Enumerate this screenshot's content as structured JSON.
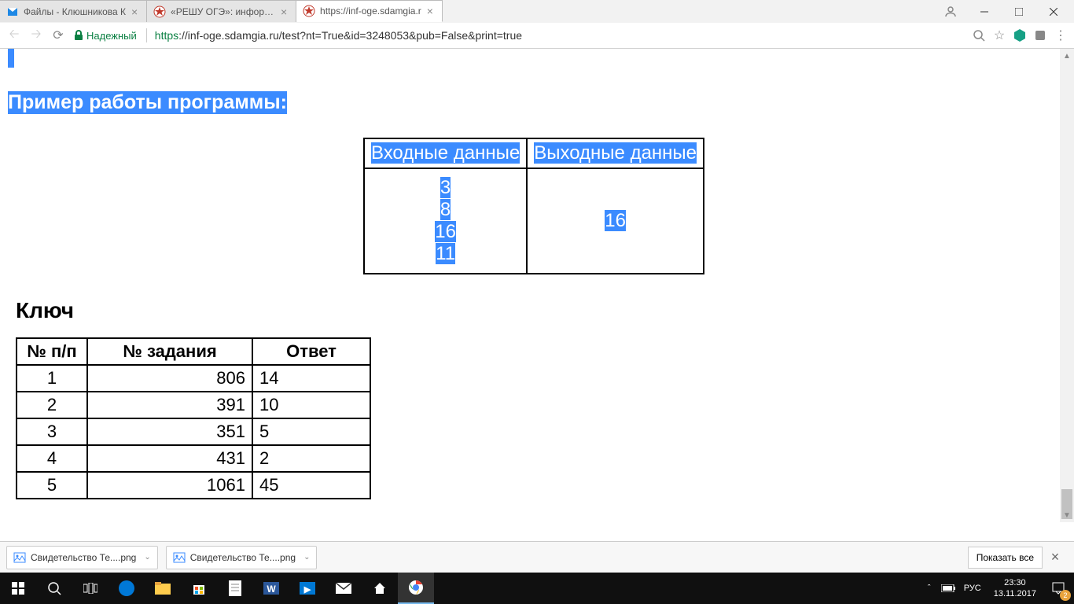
{
  "tabs": [
    {
      "title": "Файлы - Клюшникова К",
      "icon": "mail-blue"
    },
    {
      "title": "«РЕШУ ОГЭ»: информат",
      "icon": "red-star"
    },
    {
      "title": "https://inf-oge.sdamgia.r",
      "icon": "red-star",
      "active": true
    }
  ],
  "url": {
    "secure_label": "Надежный",
    "host": "https",
    "full": "://inf-oge.sdamgia.ru/test?nt=True&id=3248053&pub=False&print=true"
  },
  "page": {
    "heading": "Пример работы программы:",
    "example": {
      "headers": [
        "Входные данные",
        "Выходные данные"
      ],
      "input_lines": [
        "3",
        "8",
        "16",
        "11"
      ],
      "output": "16"
    },
    "key_heading": "Ключ",
    "key_headers": [
      "№ п/п",
      "№ задания",
      "Ответ"
    ],
    "key_rows": [
      {
        "n": "1",
        "task": "806",
        "ans": "14"
      },
      {
        "n": "2",
        "task": "391",
        "ans": "10"
      },
      {
        "n": "3",
        "task": "351",
        "ans": "5"
      },
      {
        "n": "4",
        "task": "431",
        "ans": "2"
      },
      {
        "n": "5",
        "task": "1061",
        "ans": "45"
      }
    ]
  },
  "downloads": {
    "items": [
      {
        "name": "Свидетельство Те....png"
      },
      {
        "name": "Свидетельство Те....png"
      }
    ],
    "show_all": "Показать все"
  },
  "taskbar": {
    "lang": "РУС",
    "time": "23:30",
    "date": "13.11.2017",
    "notif_count": "2"
  }
}
